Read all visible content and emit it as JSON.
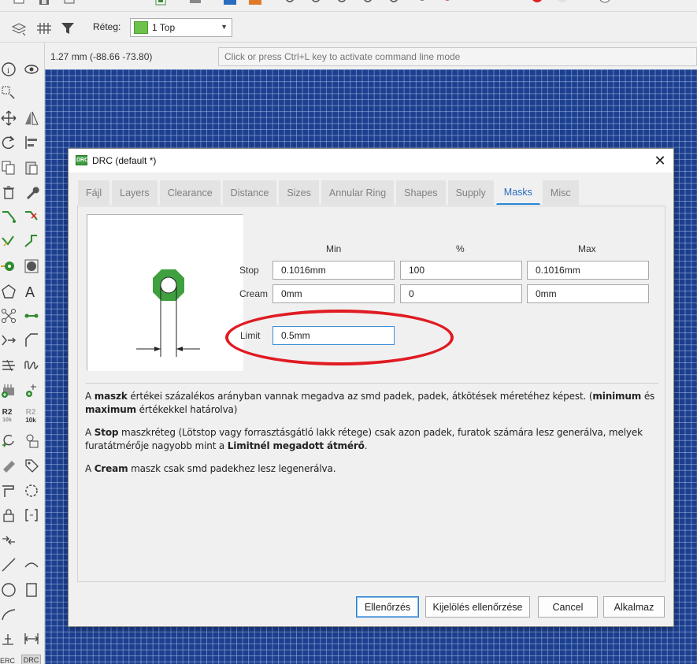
{
  "toolbar": {
    "layer_label": "Réteg:",
    "layer_value": "1 Top",
    "layer_color": "#6cc24a"
  },
  "coord_bar": {
    "coordinates": "1.27 mm (-88.66 -73.80)",
    "command_placeholder": "Click or press Ctrl+L key to activate command line mode"
  },
  "left_toolbar": {
    "r2_label": "R2",
    "r2_sub": "10k",
    "r2b_label": "R2",
    "r2b_sub": "10k",
    "erc_label": "ERC",
    "drc_label": "DRC"
  },
  "dialog": {
    "title": "DRC (default *)",
    "close_glyph": "✕",
    "icon_text": "DRC",
    "tabs": [
      {
        "label": "Fájl",
        "active": false
      },
      {
        "label": "Layers",
        "active": false
      },
      {
        "label": "Clearance",
        "active": false
      },
      {
        "label": "Distance",
        "active": false
      },
      {
        "label": "Sizes",
        "active": false
      },
      {
        "label": "Annular Ring",
        "active": false
      },
      {
        "label": "Shapes",
        "active": false
      },
      {
        "label": "Supply",
        "active": false
      },
      {
        "label": "Masks",
        "active": true
      },
      {
        "label": "Misc",
        "active": false
      }
    ],
    "masks": {
      "col_min": "Min",
      "col_percent": "%",
      "col_max": "Max",
      "stop_label": "Stop",
      "stop_min": "0.1016mm",
      "stop_percent": "100",
      "stop_max": "0.1016mm",
      "cream_label": "Cream",
      "cream_min": "0mm",
      "cream_percent": "0",
      "cream_max": "0mm",
      "limit_label": "Limit",
      "limit_value": "0.5mm"
    },
    "description": {
      "p1": [
        "A ",
        "maszk",
        " értékei százalékos arányban vannak megadva az smd padek, padek, átkötések méretéhez képest. (",
        "minimum",
        " és ",
        "maximum",
        " értékekkel határolva)"
      ],
      "p2": [
        "A ",
        "Stop",
        " maszkréteg (Lötstop vagy forrasztásgátló lakk rétege) csak azon padek, furatok számára lesz generálva, melyek furatátmérője nagyobb mint a ",
        "Limitnél megadott átmérő",
        "."
      ],
      "p3": [
        "A ",
        "Cream",
        " maszk csak smd padekhez lesz legenerálva."
      ]
    },
    "buttons": {
      "check": "Ellenőrzés",
      "check_selected": "Kijelölés ellenőrzése",
      "cancel": "Cancel",
      "apply": "Alkalmaz"
    }
  },
  "colors": {
    "canvas_bg": "#1c3f8f",
    "pad_green": "#3fa03f",
    "highlight_ring": "#e01b22",
    "active_tab": "#2a87d8"
  }
}
